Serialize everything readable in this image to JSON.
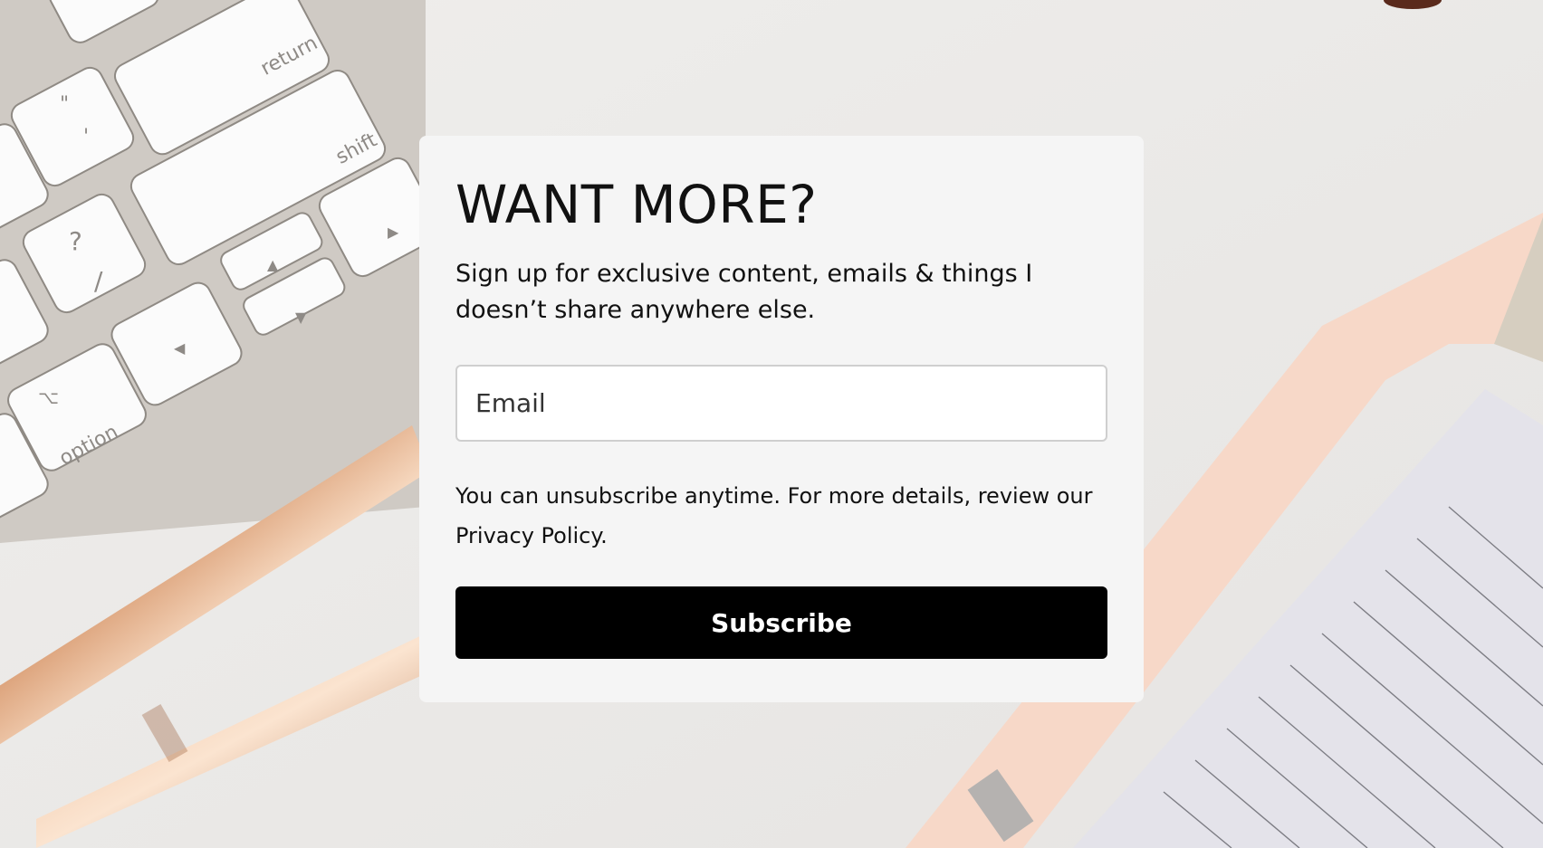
{
  "signup": {
    "headline": "WANT MORE?",
    "subtext": "Sign up for exclusive content, emails & things I doesn’t share anywhere else.",
    "email_placeholder": "Email",
    "disclaimer_text": "You can unsubscribe anytime. For more details, review our ",
    "privacy_link": "Privacy Policy",
    "disclaimer_end": ".",
    "subscribe_label": "Subscribe"
  },
  "background": {
    "keys": [
      "return",
      "shift",
      "option"
    ],
    "key_glyphs": [
      "\"",
      "'",
      "?",
      "/",
      "▲",
      "▼",
      "◀",
      "▶",
      "⌥"
    ],
    "colors": {
      "paper": "#ecebea",
      "key": "#fbfbfb",
      "keyboard_frame": "#cfcac4",
      "rose_gold": "#d9a07b",
      "peach": "#f7d8c8",
      "notebook": "#e4e3ea"
    }
  }
}
